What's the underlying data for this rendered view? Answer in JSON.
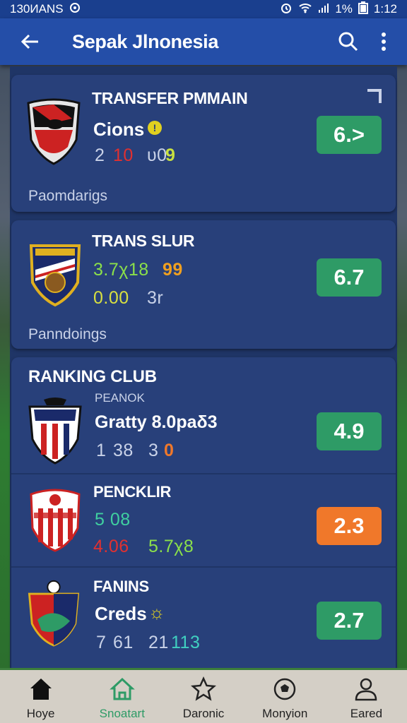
{
  "status_bar": {
    "left_text": "130ИANS",
    "battery_pct": "1%",
    "time": "1:12"
  },
  "app_bar": {
    "title": "Sepak Jlnonesia"
  },
  "cards": [
    {
      "title": "TRANSFER PMMAIN",
      "name": "Cions",
      "stat_a": "2",
      "stat_b": "10",
      "stat_c": "υ0",
      "stat_d": "9",
      "footer": "Paomdarigs",
      "score": "6.>"
    },
    {
      "title": "TRANS SLUR",
      "line1_a": "3.7χ18",
      "line1_b": "99",
      "line2_a": "0.00",
      "line2_b": "3r",
      "footer": "Panndoings",
      "score": "6.7"
    }
  ],
  "ranking": {
    "title": "RANKING CLUB",
    "items": [
      {
        "label": "PEANOK",
        "name": "Gratty 8.0paδ3",
        "stat_a": "1",
        "stat_b": "38",
        "stat_c": "3",
        "stat_d": "0",
        "score": "4.9",
        "score_color": "#2e9b66"
      },
      {
        "label": "PENCKLIR",
        "line1": "5 08",
        "line2_a": "4.06",
        "line2_b": "5.7χ8",
        "score": "2.3",
        "score_color": "#f0782a"
      },
      {
        "label": "FANINS",
        "name": "Creds",
        "name_mark": "☼",
        "stat_a": "7",
        "stat_b": "61",
        "stat_c": "21",
        "stat_d": "113",
        "score": "2.7",
        "score_color": "#2e9b66"
      }
    ]
  },
  "nav": [
    {
      "label": "Hoye",
      "icon": "home-icon"
    },
    {
      "label": "Snoatart",
      "icon": "stadium-icon",
      "active": true
    },
    {
      "label": "Daronic",
      "icon": "star-icon"
    },
    {
      "label": "Monyion",
      "icon": "ball-icon"
    },
    {
      "label": "Eared",
      "icon": "profile-icon"
    }
  ],
  "colors": {
    "primary": "#244ea8",
    "card": "#28407a",
    "green": "#2e9b66",
    "orange": "#f0782a"
  }
}
